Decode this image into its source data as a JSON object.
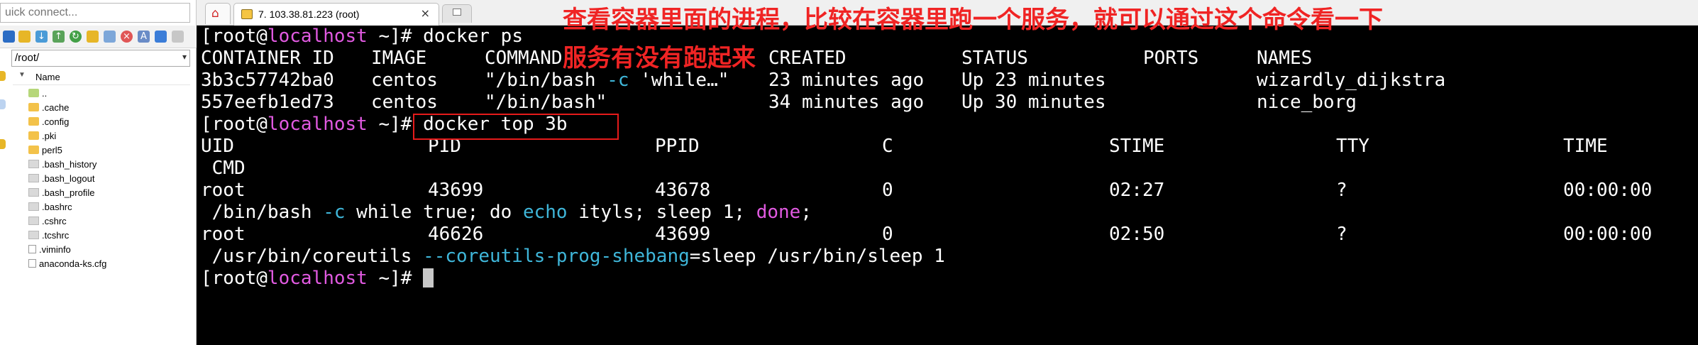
{
  "left_panel": {
    "quick_connect_placeholder": "uick connect...",
    "path": "/root/",
    "tree_header": "Name",
    "tree_items": [
      {
        "label": "..",
        "icon": "folder-up-icon"
      },
      {
        "label": ".cache",
        "icon": "folder-icon"
      },
      {
        "label": ".config",
        "icon": "folder-icon"
      },
      {
        "label": ".pki",
        "icon": "folder-icon"
      },
      {
        "label": "perl5",
        "icon": "folder-icon"
      },
      {
        "label": ".bash_history",
        "icon": "file-icon"
      },
      {
        "label": ".bash_logout",
        "icon": "file-icon"
      },
      {
        "label": ".bash_profile",
        "icon": "file-icon"
      },
      {
        "label": ".bashrc",
        "icon": "file-icon"
      },
      {
        "label": ".cshrc",
        "icon": "file-icon"
      },
      {
        "label": ".tcshrc",
        "icon": "file-icon"
      },
      {
        "label": ".viminfo",
        "icon": "document-icon"
      },
      {
        "label": "anaconda-ks.cfg",
        "icon": "document-icon"
      }
    ]
  },
  "tabs": {
    "home_icon": "home-icon",
    "session_title": "7. 103.38.81.223 (root)",
    "close_glyph": "×"
  },
  "terminal": {
    "prompt_open": "[root@",
    "prompt_host": "localhost",
    "prompt_close": " ~]# ",
    "cmd1": "docker ps",
    "ps_headers": [
      "CONTAINER ID",
      "IMAGE",
      "COMMAND",
      "CREATED",
      "STATUS",
      "PORTS",
      "NAMES"
    ],
    "ps_rows": [
      {
        "id": "3b3c57742ba0",
        "image": "centos",
        "command_a": "\"/bin/bash ",
        "command_flag": "-c",
        "command_b": " 'while…\"",
        "created": "23 minutes ago",
        "status": "Up 23 minutes",
        "ports": "",
        "names": "wizardly_dijkstra"
      },
      {
        "id": "557eefb1ed73",
        "image": "centos",
        "command_a": "\"/bin/bash\"",
        "command_flag": "",
        "command_b": "",
        "created": "34 minutes ago",
        "status": "Up 30 minutes",
        "ports": "",
        "names": "nice_borg"
      }
    ],
    "cmd2": "docker top 3b",
    "top_headers": [
      "UID",
      "PID",
      "PPID",
      "C",
      "STIME",
      "TTY",
      "TIME"
    ],
    "top_cmd_header": " CMD",
    "top_rows": [
      {
        "uid": "root",
        "pid": "43699",
        "ppid": "43678",
        "c": "0",
        "stime": "02:27",
        "tty": "?",
        "time": "00:00:00"
      },
      {
        "uid": "root",
        "pid": "46626",
        "ppid": "43699",
        "c": "0",
        "stime": "02:50",
        "tty": "?",
        "time": "00:00:00"
      }
    ],
    "cmd_line1_parts": {
      "a": " /bin/bash ",
      "b": "-c",
      "c": " while true; do ",
      "d": "echo",
      "e": " ityls; sleep 1; ",
      "f": "done",
      "g": ";"
    },
    "cmd_line2_parts": {
      "a": " /usr/bin/coreutils ",
      "b": "--coreutils-prog-shebang",
      "c": "=sleep /usr/bin/sleep 1"
    }
  },
  "annotation": {
    "line1": "查看容器里面的进程，比较在容器里跑一个服务，就可以通过这个命令看一下",
    "line2": "服务有没有跑起来",
    "color": "#f02424"
  },
  "colors": {
    "prompt_host": "#e15ae1",
    "flag": "#3fb6d9",
    "highlight_box": "#e51b1b"
  }
}
